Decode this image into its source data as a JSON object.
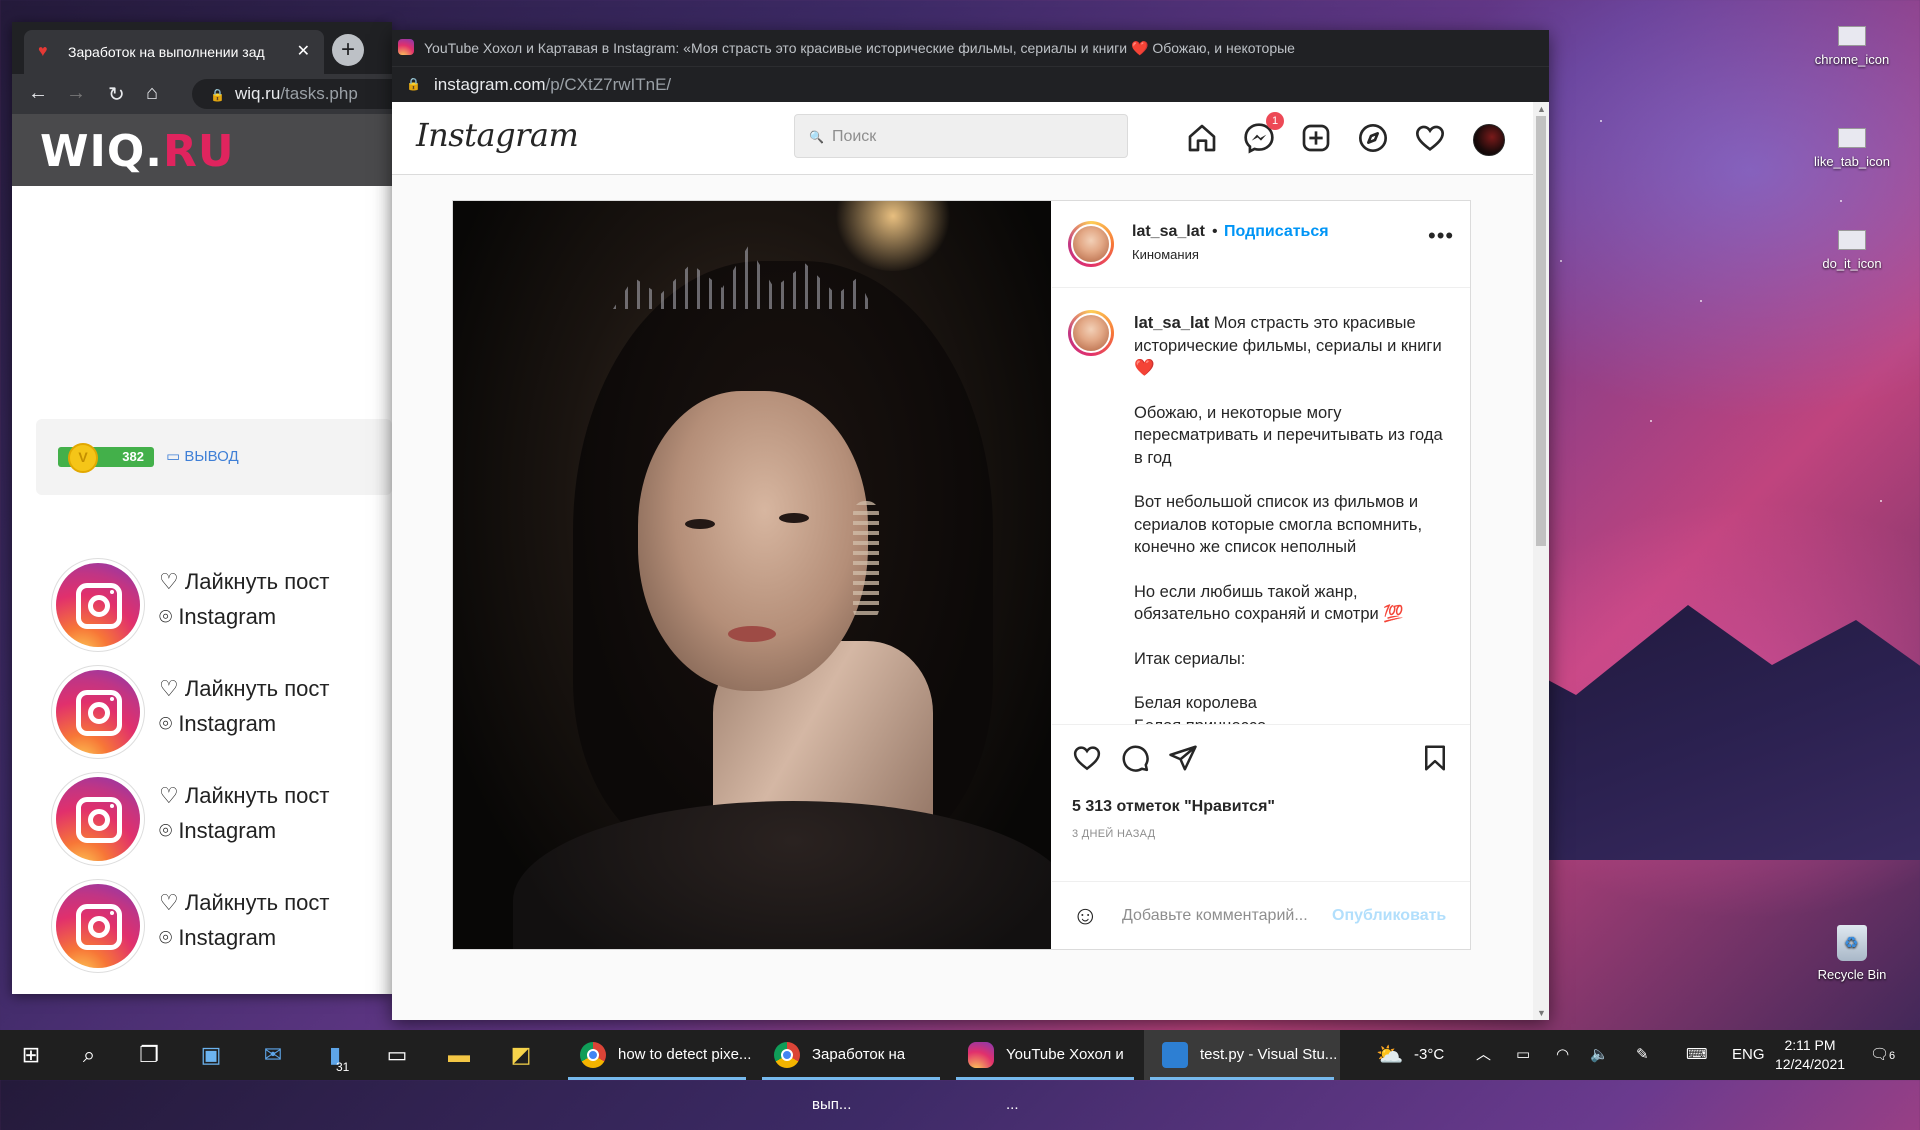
{
  "desktop": {
    "icons": [
      {
        "label": "chrome_icon"
      },
      {
        "label": "like_tab_icon"
      },
      {
        "label": "do_it_icon"
      },
      {
        "label": "Recycle Bin"
      }
    ]
  },
  "wiq_window": {
    "tab_title": "Заработок на выполнении зад",
    "url_host": "wiq.ru",
    "url_path": "/tasks.php",
    "logo_main": "WIQ.",
    "logo_accent": "RU",
    "balance": "382",
    "withdraw_label": "ВЫВОД",
    "tasks": [
      {
        "action": "♡ Лайкнуть пост",
        "network": "Instagram"
      },
      {
        "action": "♡ Лайкнуть пост",
        "network": "Instagram"
      },
      {
        "action": "♡ Лайкнуть пост",
        "network": "Instagram"
      },
      {
        "action": "♡ Лайкнуть пост",
        "network": "Instagram"
      }
    ]
  },
  "instagram_window": {
    "tab_title": "YouTube Хохол и Картавая в Instagram: «Моя страсть это красивые исторические фильмы, сериалы и книги ❤️  Обожаю, и некоторые",
    "url_host": "instagram.com",
    "url_path": "/p/CXtZ7rwITnE/",
    "logo": "Instagram",
    "search_placeholder": "Поиск",
    "messages_badge": "1",
    "post": {
      "username": "lat_sa_lat",
      "follow_label": "Подписаться",
      "subtitle": "Киномания",
      "caption_user": "lat_sa_lat",
      "caption_first": "Моя страсть это красивые исторические фильмы, сериалы и книги❤️",
      "caption_paragraphs": [
        "Обожаю, и некоторые могу пересматривать и перечитывать из года в год",
        "Вот небольшой список из фильмов и сериалов которые смогла вспомнить, конечно же список неполный",
        "Но если любишь такой жанр, обязательно сохраняй и смотри 💯",
        "Итак сериалы:",
        "Белая королева\nБелая принцесса"
      ],
      "likes": "5 313 отметок \"Нравится\"",
      "time_ago": "3 ДНЕЙ НАЗАД",
      "comment_placeholder": "Добавьте комментарий...",
      "publish_label": "Опубликовать"
    }
  },
  "taskbar": {
    "apps": [
      {
        "label": "how to detect pixe...",
        "icon": "chrome-icon"
      },
      {
        "label": "Заработок на вып...",
        "icon": "chrome-icon"
      },
      {
        "label": "YouTube Хохол и ...",
        "icon": "instagram-icon"
      },
      {
        "label": "test.py - Visual Stu...",
        "icon": "vscode-icon"
      }
    ],
    "weather": "-3°C",
    "language": "ENG",
    "time": "2:11 PM",
    "date": "12/24/2021",
    "notifications": "6",
    "calendar_day": "31"
  }
}
